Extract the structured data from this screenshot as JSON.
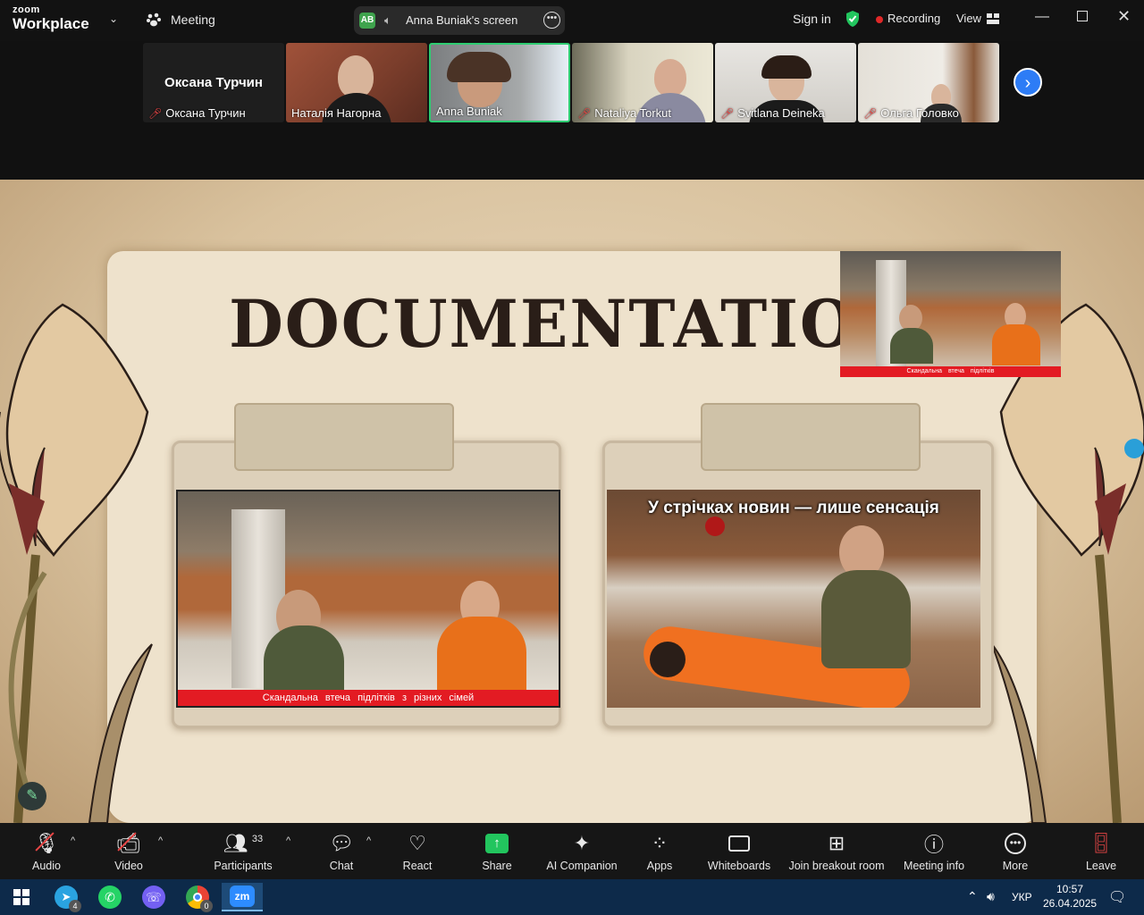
{
  "titlebar": {
    "logo_small": "zoom",
    "logo_big": "Workplace",
    "meeting_label": "Meeting",
    "screen_label": "Anna Buniak's screen",
    "initials": "AB",
    "sign_in": "Sign in",
    "recording": "Recording",
    "view": "View"
  },
  "participants": [
    {
      "name": "Оксана Турчин",
      "display": "Оксана Турчин",
      "muted": true,
      "video": false
    },
    {
      "name": "Наталія Нагорна",
      "muted": false,
      "video": true
    },
    {
      "name": "Anna Buniak",
      "muted": false,
      "video": true,
      "active": true
    },
    {
      "name": "Nataliya Torkut",
      "muted": true,
      "video": true
    },
    {
      "name": "Svitlana Deineka",
      "muted": true,
      "video": true
    },
    {
      "name": "Ольга Головко",
      "muted": true,
      "video": true
    }
  ],
  "faces": "[ANNOTATION]",
  "slide": {
    "title": "DOCUMENTATION",
    "left_caption": "Скандальна втеча підлітків з різних сімей",
    "right_subtitle": "У стрічках новин — лише сенсація",
    "pip_caption": "Скандальна втеча підлітків"
  },
  "toolbar": {
    "audio": "Audio",
    "video": "Video",
    "participants": "Participants",
    "participants_count": "33",
    "chat": "Chat",
    "react": "React",
    "share": "Share",
    "ai": "AI Companion",
    "apps": "Apps",
    "whiteboards": "Whiteboards",
    "breakout": "Join breakout room",
    "info": "Meeting info",
    "more": "More",
    "leave": "Leave"
  },
  "taskbar": {
    "telegram_badge": "4",
    "chrome_badge": "0",
    "lang": "УКР",
    "time": "10:57",
    "date": "26.04.2025"
  },
  "colors": {
    "accent_blue": "#2d7cf6",
    "share_green": "#22c55e",
    "record_red": "#e02828",
    "caption_red": "#e31b23"
  }
}
